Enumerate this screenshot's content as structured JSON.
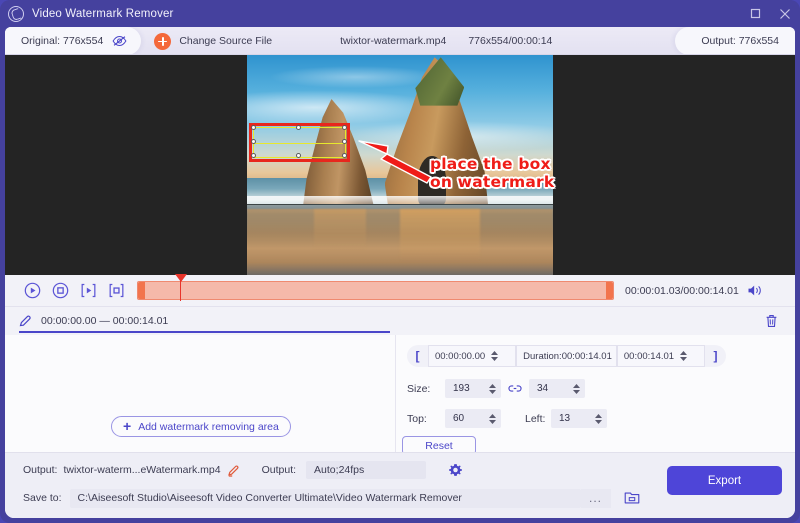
{
  "window": {
    "title": "Video Watermark Remover",
    "logo_icon": "app-logo-icon",
    "maximize_icon": "maximize-icon",
    "close_icon": "close-icon"
  },
  "infobar": {
    "original_label": "Original: 776x554",
    "eye_icon": "eye-slash-icon",
    "change_source_label": "Change Source File",
    "plus_icon": "plus-circle-icon",
    "file_name": "twixtor-watermark.mp4",
    "resolution_duration": "776x554/00:00:14",
    "output_label": "Output: 776x554"
  },
  "preview": {
    "annotation_text_line1": "place the box",
    "annotation_text_line2": "on watermark",
    "arrow_icon": "red-arrow-icon",
    "selection_box_name": "watermark-selection-box",
    "annotation_color": "#ef1c18"
  },
  "playback": {
    "play_icon": "play-circle-icon",
    "stop_icon": "stop-circle-icon",
    "mark_in_icon": "bracket-play-icon",
    "mark_out_icon": "bracket-stop-icon",
    "time_readout": "00:00:01.03/00:00:14.01",
    "volume_icon": "speaker-icon"
  },
  "segment": {
    "edit_icon": "pen-icon",
    "time_range": "00:00:00.00 — 00:00:14.01",
    "delete_icon": "trash-icon"
  },
  "left_pane": {
    "add_area_label": "Add watermark removing area",
    "add_icon": "plus-icon"
  },
  "right_pane": {
    "bracket_left": "[",
    "bracket_right": "]",
    "start_time": "00:00:00.00",
    "duration_label": "Duration:00:00:14.01",
    "end_time": "00:00:14.01",
    "size_label": "Size:",
    "size_width": "193",
    "size_height": "34",
    "link_icon": "chain-link-icon",
    "top_label": "Top:",
    "top_value": "60",
    "left_label": "Left:",
    "left_value": "13",
    "reset_label": "Reset"
  },
  "bottom": {
    "output_label": "Output:",
    "output_filename": "twixtor-waterm...eWatermark.mp4",
    "edit_icon": "pencil-icon",
    "format_label": "Output:",
    "format_value": "Auto;24fps",
    "settings_icon": "gear-icon",
    "save_to_label": "Save to:",
    "save_path": "C:\\Aiseesoft Studio\\Aiseesoft Video Converter Ultimate\\Video Watermark Remover",
    "browse_dots": "...",
    "folder_icon": "folder-icon",
    "export_label": "Export"
  }
}
